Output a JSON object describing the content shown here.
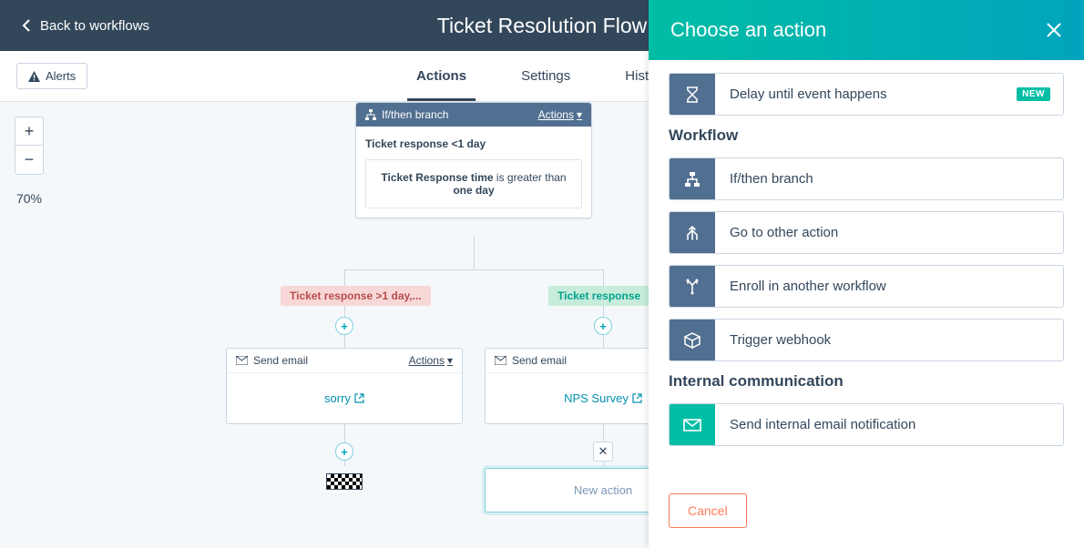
{
  "header": {
    "back_label": "Back to workflows",
    "title": "Ticket Resolution Flow"
  },
  "toolbar": {
    "alerts_label": "Alerts",
    "tabs": {
      "actions": "Actions",
      "settings": "Settings",
      "history": "History"
    }
  },
  "zoom": {
    "level": "70%",
    "plus": "+",
    "minus": "−"
  },
  "branch_node": {
    "type_label": "If/then branch",
    "actions_label": "Actions",
    "subtitle": "Ticket response <1 day",
    "rule_prefix": "Ticket Response time",
    "rule_mid": " is greater than ",
    "rule_bold": "one day"
  },
  "chips": {
    "left": "Ticket response >1 day,...",
    "right": "Ticket response"
  },
  "email_nodes": {
    "header_label": "Send email",
    "actions_label": "Actions",
    "left_link": "sorry",
    "right_link": "NPS Survey"
  },
  "new_action_label": "New action",
  "panel": {
    "title": "Choose an action",
    "item_delay": "Delay until event happens",
    "new_badge": "NEW",
    "section_workflow": "Workflow",
    "item_ifthen": "If/then branch",
    "item_goto": "Go to other action",
    "item_enroll": "Enroll in another workflow",
    "item_webhook": "Trigger webhook",
    "section_internal": "Internal communication",
    "item_internal_email": "Send internal email notification",
    "cancel": "Cancel"
  }
}
